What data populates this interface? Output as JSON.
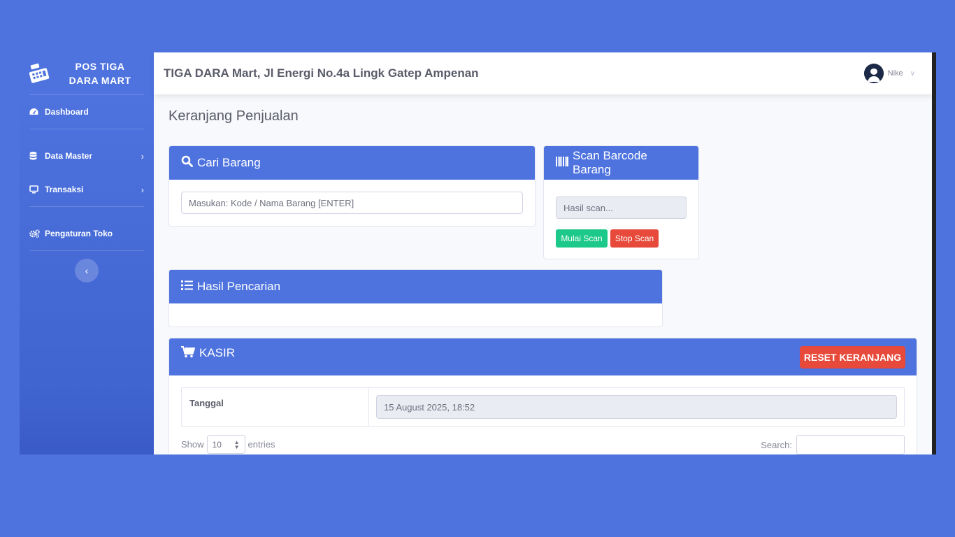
{
  "brand": {
    "line1": "POS TIGA",
    "line2": "DARA MART",
    "icon": "cash-register-icon"
  },
  "sidebar": {
    "items": [
      {
        "label": "Dashboard",
        "icon": "tachometer-icon"
      },
      {
        "label": "Data Master",
        "icon": "database-icon",
        "has_submenu": true
      },
      {
        "label": "Transaksi",
        "icon": "desktop-icon",
        "has_submenu": true
      },
      {
        "label": "Pengaturan Toko",
        "icon": "cogs-icon"
      }
    ],
    "toggle_icon": "chevron-left-icon"
  },
  "topbar": {
    "title": "TIGA DARA Mart, Jl Energi No.4a Lingk Gatep Ampenan",
    "user_name": "Nike"
  },
  "page": {
    "title": "Keranjang Penjualan"
  },
  "search_card": {
    "title": "Cari Barang",
    "placeholder": "Masukan: Kode / Nama Barang [ENTER]"
  },
  "scan_card": {
    "title": "Scan Barcode Barang",
    "placeholder": "Hasil scan...",
    "start_label": "Mulai Scan",
    "stop_label": "Stop Scan"
  },
  "results_card": {
    "title": "Hasil Pencarian"
  },
  "kasir_card": {
    "title": "KASIR",
    "reset_label": "RESET KERANJANG",
    "date_label": "Tanggal",
    "date_value": "15 August 2025, 18:52",
    "show_label": "Show",
    "entries_value": "10",
    "entries_label": "entries",
    "search_label": "Search:"
  },
  "colors": {
    "primary": "#4e73df",
    "success": "#1cc88a",
    "danger": "#e74a3b"
  }
}
